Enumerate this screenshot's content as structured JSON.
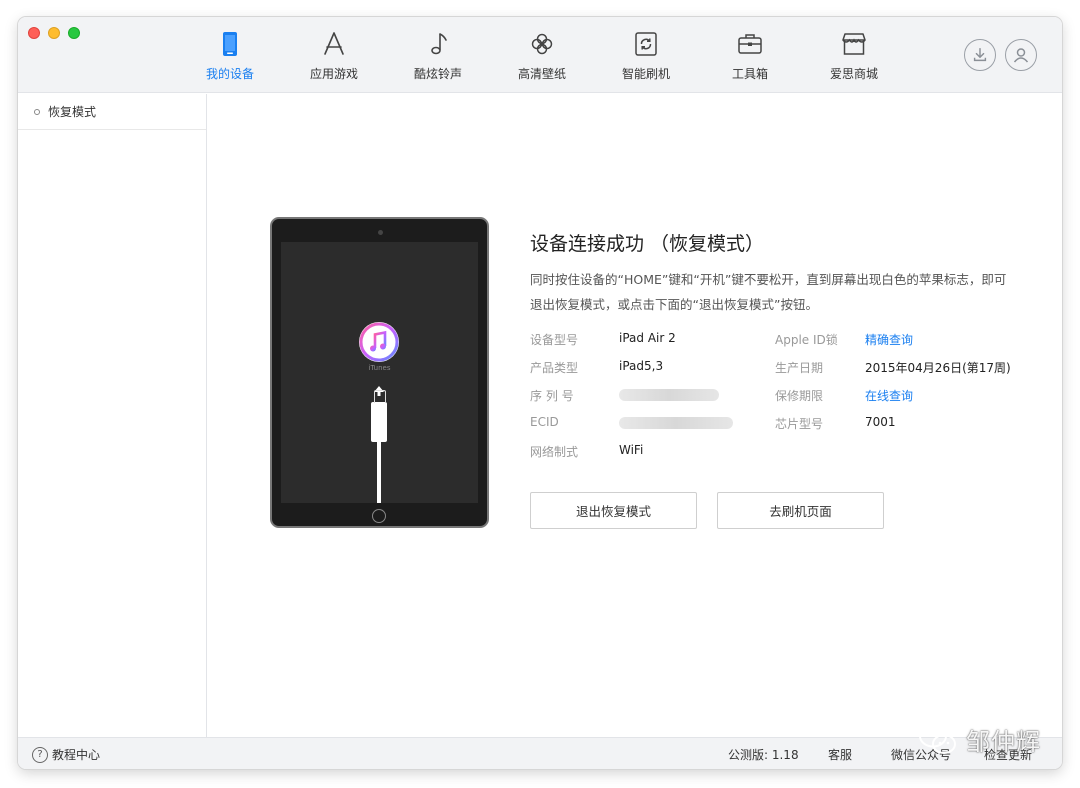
{
  "toolbar": {
    "nav": [
      {
        "label": "我的设备",
        "icon": "tablet-icon",
        "active": true
      },
      {
        "label": "应用游戏",
        "icon": "app-store-icon"
      },
      {
        "label": "酷炫铃声",
        "icon": "music-note-icon"
      },
      {
        "label": "高清壁纸",
        "icon": "flower-icon"
      },
      {
        "label": "智能刷机",
        "icon": "refresh-device-icon"
      },
      {
        "label": "工具箱",
        "icon": "toolbox-icon"
      },
      {
        "label": "爱思商城",
        "icon": "store-icon"
      }
    ],
    "accent_color": "#1a7ff0"
  },
  "sidebar": {
    "items": [
      {
        "label": "恢复模式"
      }
    ]
  },
  "device_image": {
    "app_label": "iTunes"
  },
  "info": {
    "title": "设备连接成功 （恢复模式）",
    "description": "同时按住设备的“HOME”键和“开机”键不要松开，直到屏幕出现白色的苹果标志，即可退出恢复模式，或点击下面的“退出恢复模式”按钮。",
    "specs_left": [
      {
        "label": "设备型号",
        "value": "iPad Air 2"
      },
      {
        "label": "产品类型",
        "value": "iPad5,3"
      },
      {
        "label": "序 列 号",
        "value": ""
      },
      {
        "label": "ECID",
        "value": ""
      },
      {
        "label": "网络制式",
        "value": "WiFi"
      }
    ],
    "specs_right": [
      {
        "label": "Apple ID锁",
        "value": "精确查询",
        "link": true
      },
      {
        "label": "生产日期",
        "value": "2015年04月26日(第17周)"
      },
      {
        "label": "保修期限",
        "value": "在线查询",
        "link": true
      },
      {
        "label": "芯片型号",
        "value": "7001"
      }
    ],
    "buttons": {
      "exit_recovery": "退出恢复模式",
      "goto_flash": "去刷机页面"
    }
  },
  "statusbar": {
    "help": "教程中心",
    "version": "公测版: 1.18",
    "support": "客服",
    "wechat": "微信公众号",
    "check_update": "检查更新"
  },
  "watermark": {
    "text": "邹仲辉"
  }
}
